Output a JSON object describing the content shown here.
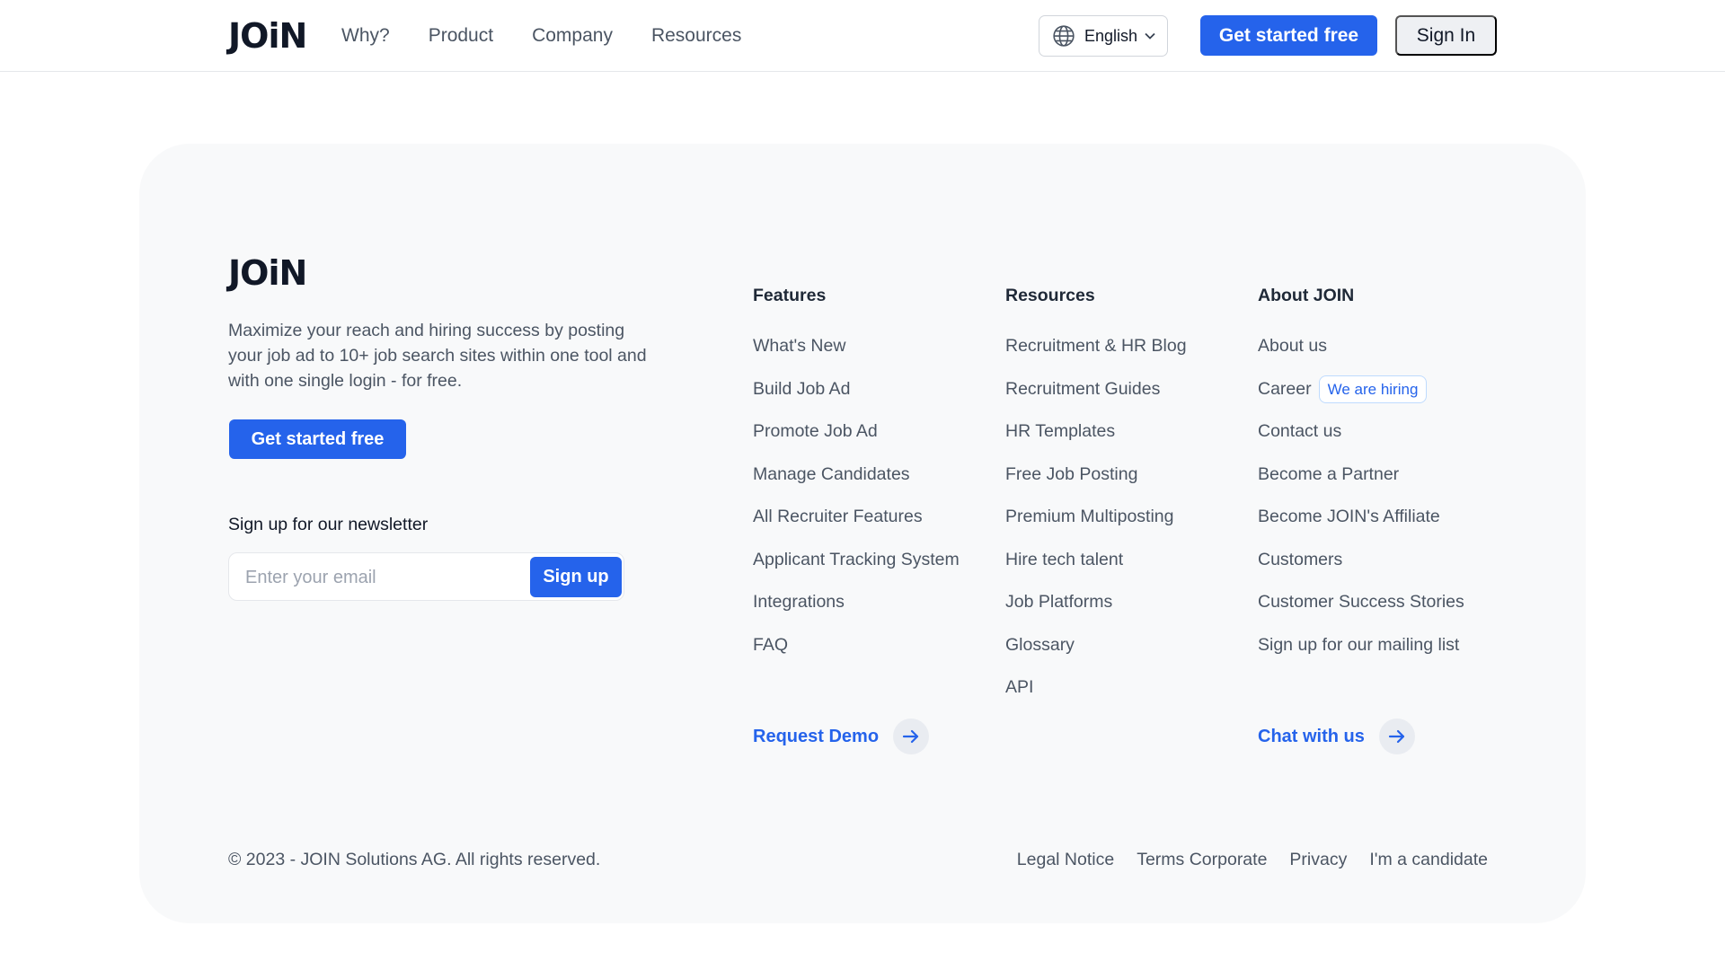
{
  "header": {
    "logo": "JOiN",
    "nav": [
      "Why?",
      "Product",
      "Company",
      "Resources"
    ],
    "language": "English",
    "cta_label": "Get started free",
    "signin_label": "Sign In"
  },
  "footer": {
    "logo": "JOiN",
    "tagline": "Maximize your reach and hiring success by posting your job ad to 10+ job search sites within one tool and with one single login - for free.",
    "cta_label": "Get started free",
    "newsletter": {
      "title": "Sign up for our newsletter",
      "placeholder": "Enter your email",
      "button": "Sign up"
    },
    "columns": {
      "features": {
        "title": "Features",
        "items": [
          "What's New",
          "Build Job Ad",
          "Promote Job Ad",
          "Manage Candidates",
          "All Recruiter Features",
          "Applicant Tracking System",
          "Integrations",
          "FAQ"
        ],
        "action": "Request Demo"
      },
      "resources": {
        "title": "Resources",
        "items": [
          "Recruitment & HR Blog",
          "Recruitment Guides",
          "HR Templates",
          "Free Job Posting",
          "Premium Multiposting",
          "Hire tech talent",
          "Job Platforms",
          "Glossary",
          "API"
        ]
      },
      "about": {
        "title": "About JOIN",
        "items": [
          "About us",
          "Career",
          "Contact us",
          "Become a Partner",
          "Become JOIN's Affiliate",
          "Customers",
          "Customer Success Stories",
          "Sign up for our mailing list"
        ],
        "badge": "We are hiring",
        "action": "Chat with us"
      }
    },
    "copyright": "© 2023 - JOIN Solutions AG. All rights reserved.",
    "legal": [
      "Legal Notice",
      "Terms Corporate",
      "Privacy",
      "I'm a candidate"
    ]
  },
  "colors": {
    "accent": "#2563eb",
    "card_bg": "#f8f9fa"
  },
  "icons": {
    "globe": "globe-icon",
    "chevron": "chevron-down-icon",
    "arrow": "arrow-right-icon"
  }
}
